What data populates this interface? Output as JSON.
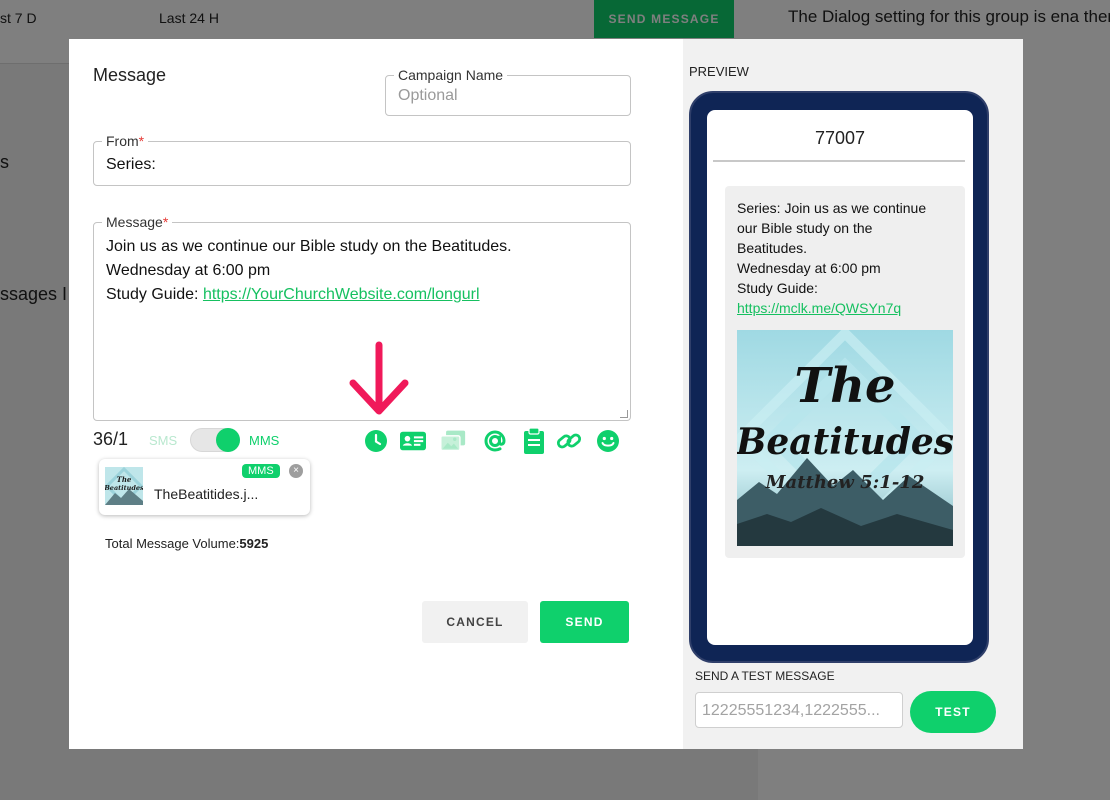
{
  "background": {
    "filters": [
      "st 7 D",
      "Last 24 H"
    ],
    "send_message_label": "SEND MESSAGE",
    "dialog_note": "The Dialog setting for this group is ena there are no incoming messages to vie",
    "side_text_1": "s",
    "side_text_2": "ssages I"
  },
  "modal": {
    "title": "Message",
    "campaign": {
      "label": "Campaign Name",
      "placeholder": "Optional"
    },
    "from": {
      "label": "From",
      "required": "*",
      "value": "Series:"
    },
    "message": {
      "label": "Message",
      "required": "*",
      "line1": "Join us as we continue our Bible study on the Beatitudes.",
      "line2": "Wednesday at 6:00 pm",
      "line3_prefix": "Study Guide: ",
      "line3_link": "https://YourChurchWebsite.com/longurl"
    },
    "toolbar": {
      "counter": "36/1",
      "sms_label": "SMS",
      "mms_label": "MMS",
      "mms_enabled": true,
      "icons": [
        "clock-icon",
        "contact-card-icon",
        "images-icon",
        "at-sign-icon",
        "clipboard-icon",
        "link-icon",
        "smiley-icon"
      ]
    },
    "attachment": {
      "filename": "TheBeatitides.j...",
      "badge": "MMS",
      "close": "×"
    },
    "volume": {
      "label": "Total Message Volume:",
      "value": "5925"
    },
    "buttons": {
      "cancel": "CANCEL",
      "send": "SEND"
    }
  },
  "preview": {
    "label": "PREVIEW",
    "phone_number": "77007",
    "bubble_lines": [
      "Series: Join us as we continue",
      "our Bible study on the",
      "Beatitudes.",
      "Wednesday at 6:00 pm",
      "Study Guide:"
    ],
    "bubble_link": "https://mclk.me/QWSYn7q",
    "image_title_1": "The",
    "image_title_2": "Beatitudes",
    "image_subtitle": "Matthew 5:1-12"
  },
  "test": {
    "label": "SEND A TEST MESSAGE",
    "placeholder": "12225551234,1222555...",
    "button": "TEST"
  },
  "colors": {
    "accent": "#0fd06c",
    "phone_frame": "#0f2555",
    "arrow": "#f0195a",
    "required": "#e53935"
  }
}
